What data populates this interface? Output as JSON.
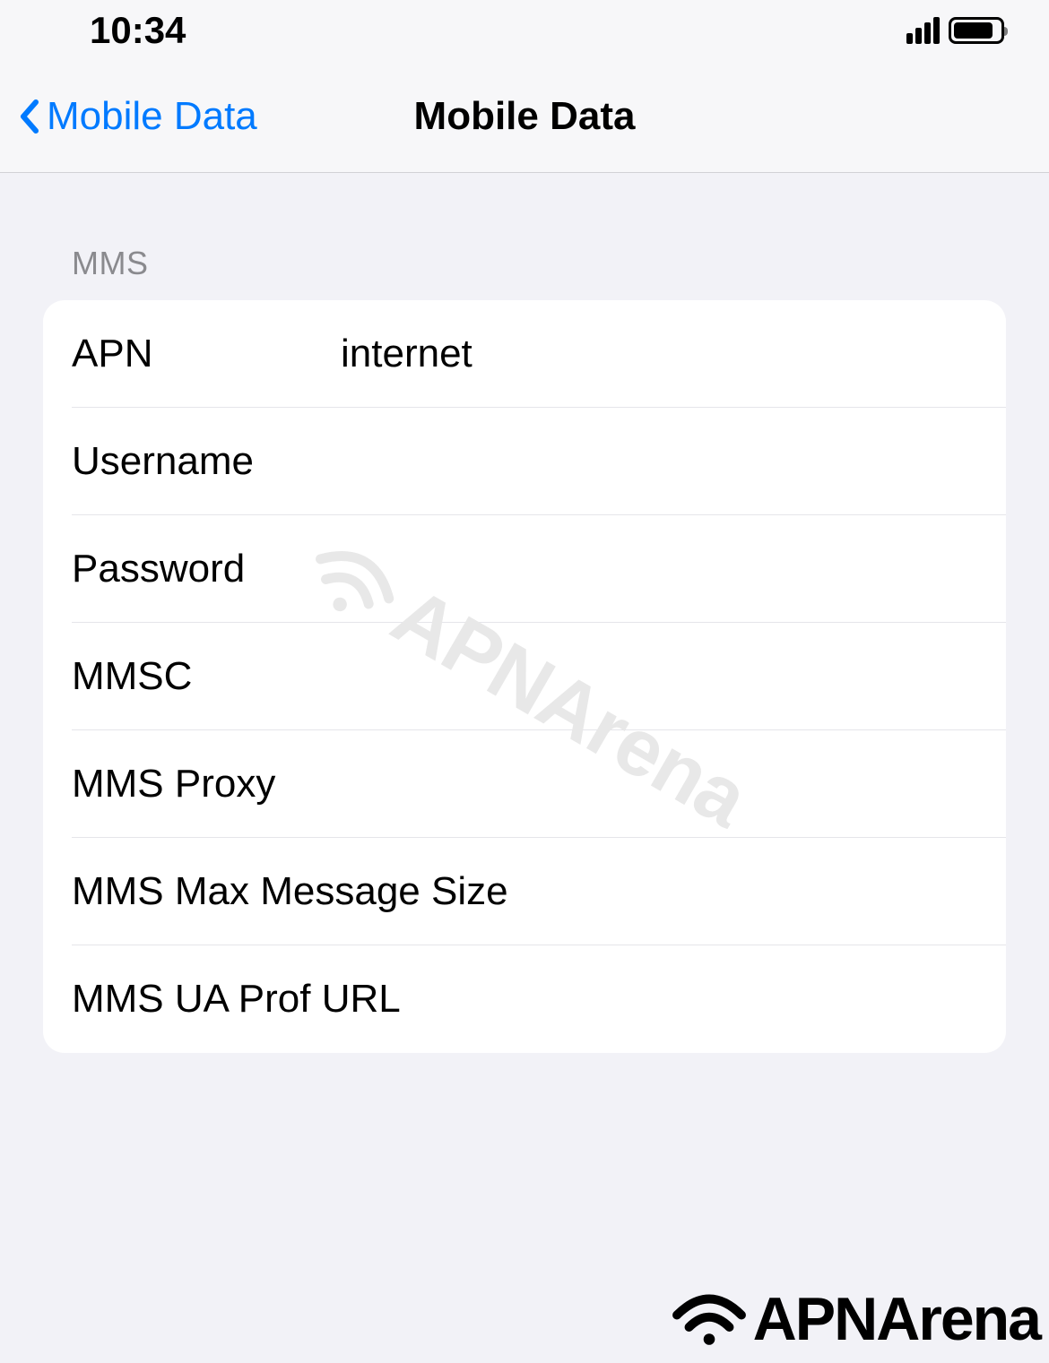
{
  "statusBar": {
    "time": "10:34"
  },
  "nav": {
    "backLabel": "Mobile Data",
    "title": "Mobile Data"
  },
  "section": {
    "header": "MMS",
    "rows": [
      {
        "label": "APN",
        "value": "internet",
        "wide": false
      },
      {
        "label": "Username",
        "value": "",
        "wide": false
      },
      {
        "label": "Password",
        "value": "",
        "wide": false
      },
      {
        "label": "MMSC",
        "value": "",
        "wide": false
      },
      {
        "label": "MMS Proxy",
        "value": "",
        "wide": false
      },
      {
        "label": "MMS Max Message Size",
        "value": "",
        "wide": true
      },
      {
        "label": "MMS UA Prof URL",
        "value": "",
        "wide": true
      }
    ]
  },
  "branding": {
    "watermark": "APNArena",
    "footer": "APNArena"
  }
}
